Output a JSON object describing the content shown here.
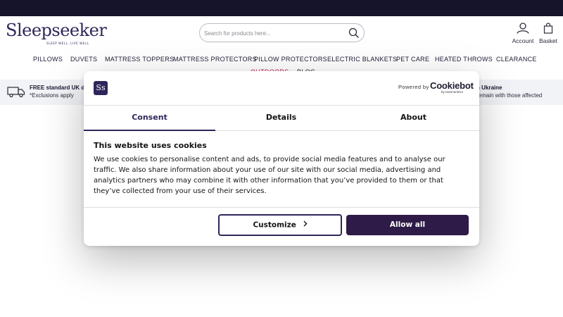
{
  "brand": {
    "name": "Sleepseeker",
    "tagline": "SLEEP WELL, LIVE WELL",
    "color": "#2e2659"
  },
  "search": {
    "placeholder": "Search for products here...",
    "icon": "search-icon"
  },
  "header": {
    "account_label": "Account",
    "basket_label": "Basket"
  },
  "nav": {
    "items": [
      {
        "label": "PILLOWS"
      },
      {
        "label": "DUVETS"
      },
      {
        "label": "MATTRESS TOPPERS"
      },
      {
        "label": "MATTRESS PROTECTORS"
      },
      {
        "label": "PILLOW PROTECTORS"
      },
      {
        "label": "ELECTRIC BLANKETS"
      },
      {
        "label": "PET CARE"
      },
      {
        "label": "HEATED THROWS"
      },
      {
        "label": "CLEARANCE"
      },
      {
        "label": "OUTDOORS"
      },
      {
        "label": "BLOG"
      }
    ]
  },
  "infobar": {
    "left_title": "FREE standard UK d",
    "left_sub": "*Exclusions apply",
    "right_title": "h Ukraine",
    "right_sub": "remain with those affected"
  },
  "cookie": {
    "logo_text": "Ss",
    "powered_by": "Powered by",
    "provider": "Cookiebot",
    "provider_sub": "by Usercentrics",
    "tabs": [
      {
        "label": "Consent",
        "active": true
      },
      {
        "label": "Details",
        "active": false
      },
      {
        "label": "About",
        "active": false
      }
    ],
    "title": "This website uses cookies",
    "body": "We use cookies to personalise content and ads, to provide social media features and to analyse our traffic. We also share information about your use of our site with our social media, advertising and analytics partners who may combine it with other information that you’ve provided to them or that they’ve collected from your use of their services.",
    "customize_label": "Customize",
    "allow_label": "Allow all",
    "accent": "#2e1b47"
  }
}
